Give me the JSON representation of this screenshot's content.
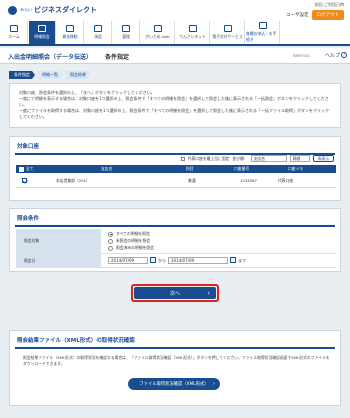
{
  "header": {
    "logo_small": "みらい",
    "logo_text": "ビジネスダイレクト",
    "logo_sub": "",
    "user_line": "前回  ご利用日時",
    "settings": "ユーザ設定",
    "logout": "ログアウト"
  },
  "nav": [
    {
      "label": "ホーム",
      "active": false
    },
    {
      "label": "明細照会",
      "active": true
    },
    {
      "label": "資金移動",
      "active": false
    },
    {
      "label": "承認",
      "active": false
    },
    {
      "label": "管理",
      "active": false
    },
    {
      "label": "がいため web",
      "active": false
    },
    {
      "label": "でんさいネット",
      "active": false
    },
    {
      "label": "電子交付サービス",
      "active": false
    },
    {
      "label": "各種お申込・お手続き",
      "active": false
    }
  ],
  "page": {
    "title": "入出金明細照会（データ伝送）",
    "subtitle": "条件指定",
    "code": "BNMT001",
    "help": "ヘルプ",
    "help_icon": "?"
  },
  "steps": [
    "条件指定",
    "明細一覧",
    "照会結果"
  ],
  "intro": {
    "lines": [
      "対象口座、照会条件を選択の上、「次へ」ボタンをクリックしてください。",
      "一度にて明細を表示する場合は、対象口座を1つ選択の上、照会条件で「すべての明細を照会」を選択して照会した後に表示される「一括照会」ボタンをクリックしてください。",
      "一度にファイルを取得する場合は、対象口座を1つ選択の上、照会条件で「すべての明細を照会」を選択して照会した後に表示される「一括ファイル取得」ボタンをクリックしてください。"
    ]
  },
  "account": {
    "title": "対象口座",
    "show_rep_label": "代表口座を最上位に固定",
    "sort_label": "並び順：",
    "sort_value": "支店名",
    "sort_order": "昇順",
    "resort": "再表示",
    "headers": [
      "全て",
      "支店名",
      "科目",
      "口座番号",
      "口座メモ"
    ],
    "rows": [
      {
        "checked": true,
        "branch": "本店営業部（201）",
        "type": "普通",
        "number": "1234567",
        "memo": "代表口座"
      }
    ]
  },
  "conditions": {
    "title": "照会条件",
    "target_label": "照会対象",
    "options": [
      "すべての明細を照会",
      "未照会の明細を照会",
      "照会済みの明細を照会"
    ],
    "selected": 0,
    "date_label": "照会日",
    "from": "2014/07/09",
    "to": "2014/07/09",
    "from_suffix": "から",
    "to_suffix": "まで"
  },
  "next_button": "次へ",
  "xml": {
    "title": "照会結果ファイル（XML形式）の取得状況確認",
    "text": "照会結果ファイル（XML形式）の取得状況を確認する場合は、「ファイル取得状況確認（XML形式）」ボタンを押してください。ファイル取得状況確認画面でXML形式のファイルをダウンロードできます。",
    "button": "ファイル取得状況確認（XML形式）"
  }
}
